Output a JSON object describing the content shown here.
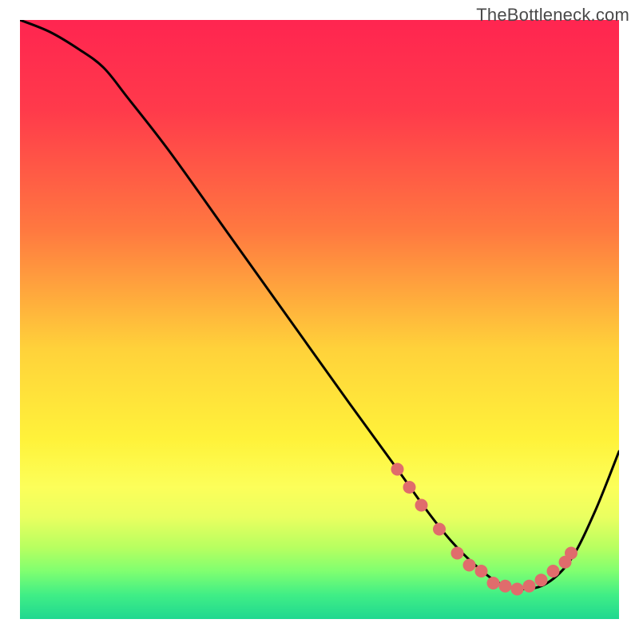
{
  "watermark": "TheBottleneck.com",
  "chart_data": {
    "type": "line",
    "title": "",
    "xlabel": "",
    "ylabel": "",
    "xlim": [
      0,
      100
    ],
    "ylim": [
      0,
      100
    ],
    "gradient_stops": [
      {
        "offset": 0,
        "color": "#ff2550"
      },
      {
        "offset": 15,
        "color": "#ff3a4b"
      },
      {
        "offset": 35,
        "color": "#ff7840"
      },
      {
        "offset": 55,
        "color": "#ffd23a"
      },
      {
        "offset": 70,
        "color": "#fff23a"
      },
      {
        "offset": 78,
        "color": "#fcff5a"
      },
      {
        "offset": 83,
        "color": "#eaff60"
      },
      {
        "offset": 88,
        "color": "#b8ff60"
      },
      {
        "offset": 92,
        "color": "#80ff70"
      },
      {
        "offset": 96,
        "color": "#40ee86"
      },
      {
        "offset": 100,
        "color": "#20d890"
      }
    ],
    "curve": {
      "name": "bottleneck-curve",
      "x": [
        0,
        5,
        10,
        14,
        18,
        25,
        35,
        45,
        55,
        63,
        68,
        72,
        76,
        80,
        84,
        88,
        92,
        96,
        100
      ],
      "y": [
        100,
        98,
        95,
        92,
        87,
        78,
        64,
        50,
        36,
        25,
        18,
        13,
        9,
        6,
        5,
        6,
        10,
        18,
        28
      ]
    },
    "markers": {
      "name": "highlight-markers",
      "color": "#e06c6c",
      "radius": 8,
      "points": [
        {
          "x": 63,
          "y": 25
        },
        {
          "x": 65,
          "y": 22
        },
        {
          "x": 67,
          "y": 19
        },
        {
          "x": 70,
          "y": 15
        },
        {
          "x": 73,
          "y": 11
        },
        {
          "x": 75,
          "y": 9
        },
        {
          "x": 77,
          "y": 8
        },
        {
          "x": 79,
          "y": 6
        },
        {
          "x": 81,
          "y": 5.5
        },
        {
          "x": 83,
          "y": 5
        },
        {
          "x": 85,
          "y": 5.5
        },
        {
          "x": 87,
          "y": 6.5
        },
        {
          "x": 89,
          "y": 8
        },
        {
          "x": 91,
          "y": 9.5
        },
        {
          "x": 92,
          "y": 11
        }
      ]
    }
  }
}
